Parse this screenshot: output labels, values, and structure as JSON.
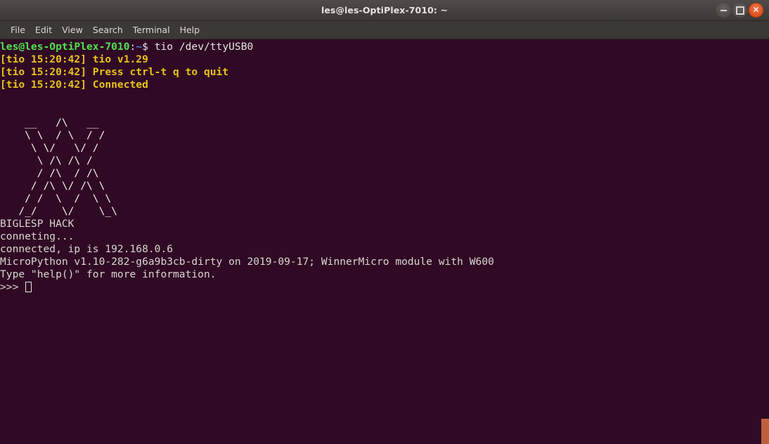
{
  "window": {
    "title": "les@les-OptiPlex-7010: ~",
    "controls": [
      {
        "name": "minimize",
        "glyph": "minimize-icon"
      },
      {
        "name": "maximize",
        "glyph": "maximize-icon"
      },
      {
        "name": "close",
        "glyph": "close-icon",
        "color": "#dd4814"
      }
    ]
  },
  "menubar": {
    "items": [
      "File",
      "Edit",
      "View",
      "Search",
      "Terminal",
      "Help"
    ]
  },
  "terminal": {
    "colors": {
      "background": "#300a24",
      "foreground": "#d3d7cf",
      "prompt_user": "#4ee24e",
      "prompt_path": "#4a7fe0",
      "log": "#e8c21a",
      "scrollbar_thumb": "#c0603c"
    },
    "prompt": {
      "user_host": "les@les-OptiPlex-7010",
      "colon": ":",
      "path": "~",
      "sigil": "$",
      "command": " tio /dev/ttyUSB0"
    },
    "log_lines": [
      "[tio 15:20:42] tio v1.29",
      "[tio 15:20:42] Press ctrl-t q to quit",
      "[tio 15:20:42] Connected"
    ],
    "ascii_art": [
      "    __   /\\   __",
      "    \\ \\  / \\  / /",
      "     \\ \\/   \\/ /",
      "      \\ /\\ /\\ /",
      "      / /\\  / /\\",
      "     / /\\ \\/ /\\ \\",
      "    / /  \\  /  \\ \\",
      "   /_/    \\/    \\_\\"
    ],
    "output_lines": [
      "BIGLESP HACK",
      "conneting...",
      "connected, ip is 192.168.0.6",
      "MicroPython v1.10-282-g6a9b3cb-dirty on 2019-09-17; WinnerMicro module with W600",
      "Type \"help()\" for more information."
    ],
    "repl_prompt": ">>> "
  }
}
